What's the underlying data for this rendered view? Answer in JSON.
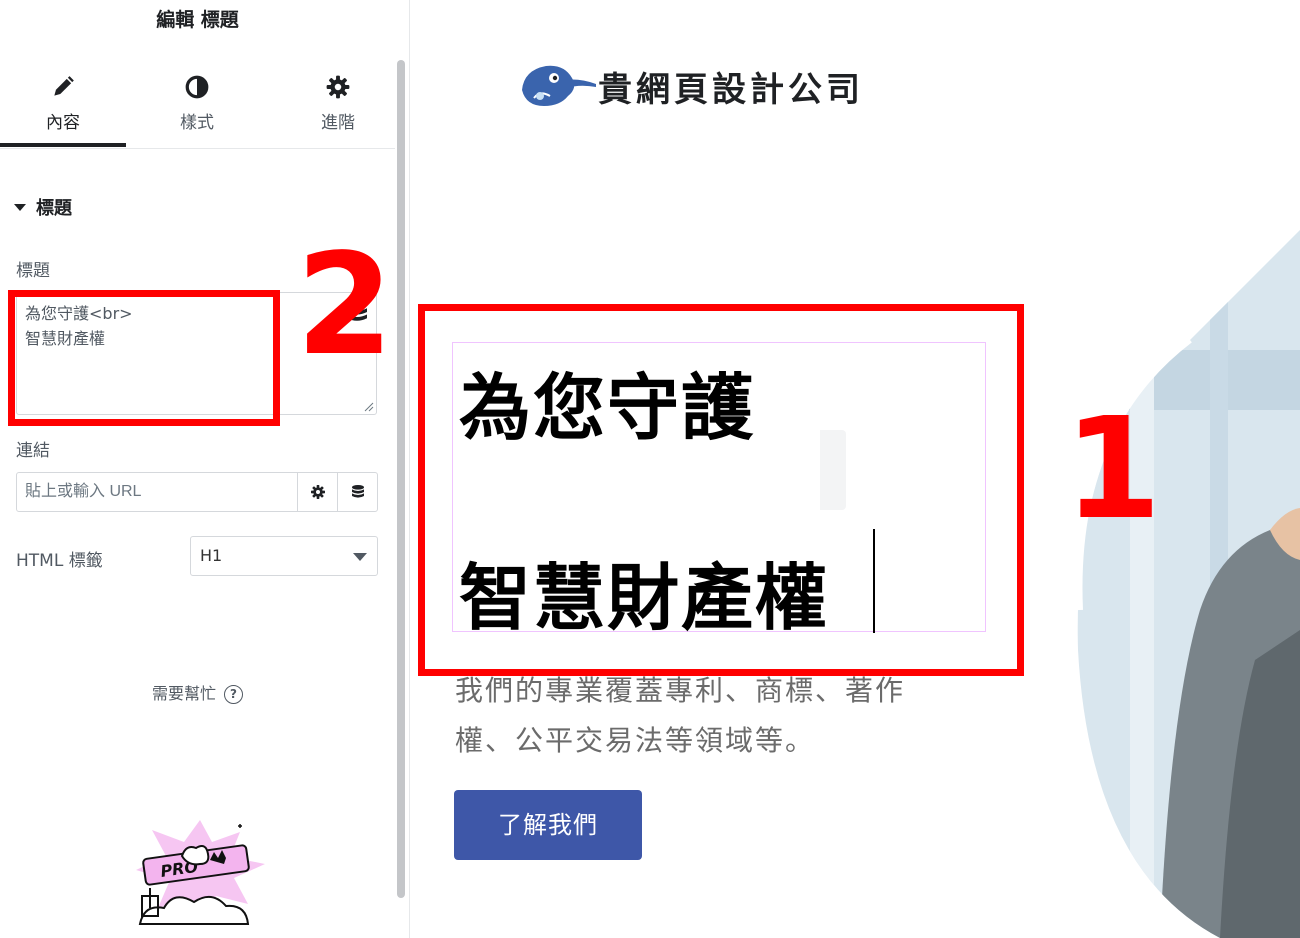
{
  "panel": {
    "header_title": "編輯 標題",
    "tabs": [
      {
        "label": "內容",
        "icon": "pencil-icon",
        "active": true
      },
      {
        "label": "樣式",
        "icon": "contrast-icon",
        "active": false
      },
      {
        "label": "進階",
        "icon": "gear-icon",
        "active": false
      }
    ],
    "section_title": "標題",
    "title_label": "標題",
    "title_value": "為您守護<br>\n智慧財產權",
    "link_label": "連結",
    "link_placeholder": "貼上或輸入 URL",
    "html_tag_label": "HTML 標籤",
    "html_tag_value": "H1",
    "help_text": "需要幫忙",
    "help_icon": "?",
    "pro_badge": "PRO"
  },
  "annotations": {
    "marker_1": "1",
    "marker_2": "2",
    "color": "#ff0000"
  },
  "preview": {
    "logo_text": "貴網頁設計公司",
    "heading_line1": "為您守護",
    "heading_line2": "智慧財產權",
    "description": "我們的專業覆蓋專利、商標、著作權、公平交易法等領域等。",
    "cta_label": "了解我們",
    "button_color": "#3e57a8",
    "accent_blue": "#7fb4e6"
  }
}
